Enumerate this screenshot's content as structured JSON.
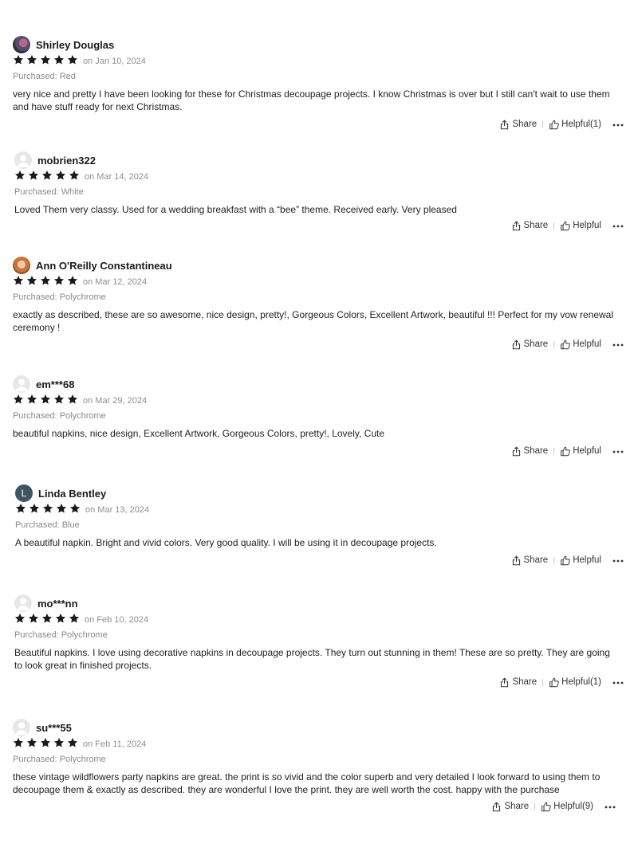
{
  "reviews": [
    {
      "name": "Shirley Douglas",
      "avatar": "photo-avatar-icon",
      "rating": 5,
      "date": "on Jan 10, 2024",
      "purchased": "Purchased: Red",
      "text": "very nice and pretty I have been looking for these for Christmas decoupage projects. I know Christmas is over but I still can't wait to use them and have stuff ready for next Christmas.",
      "share": "Share",
      "helpful": "Helpful(1)"
    },
    {
      "name": "mobrien322",
      "avatar": "default-avatar-icon",
      "rating": 5,
      "date": "on Mar 14, 2024",
      "purchased": "Purchased: White",
      "text": "Loved Them very classy. Used for a wedding breakfast with a “bee” theme. Received early. Very pleased",
      "share": "Share",
      "helpful": "Helpful"
    },
    {
      "name": "Ann O'Reilly Constantineau",
      "avatar": "photo-avatar-icon",
      "rating": 5,
      "date": "on Mar 12, 2024",
      "purchased": "Purchased: Polychrome",
      "text": "exactly as described, these are so awesome, nice design, pretty!, Gorgeous Colors, Excellent Artwork, beautiful !!! Perfect for my vow renewal ceremony !",
      "share": "Share",
      "helpful": "Helpful"
    },
    {
      "name": "em***68",
      "avatar": "default-avatar-icon",
      "rating": 5,
      "date": "on Mar 29, 2024",
      "purchased": "Purchased: Polychrome",
      "text": "beautiful napkins, nice design, Excellent Artwork, Gorgeous Colors, pretty!, Lovely, Cute",
      "share": "Share",
      "helpful": "Helpful"
    },
    {
      "name": "Linda Bentley",
      "avatar": "L",
      "rating": 5,
      "date": "on Mar 13, 2024",
      "purchased": "Purchased: Blue",
      "text": "A beautiful napkin. Bright and vivid colors. Very good quality. I will be using it in decoupage projects.",
      "share": "Share",
      "helpful": "Helpful"
    },
    {
      "name": "mo***nn",
      "avatar": "default-avatar-icon",
      "rating": 5,
      "date": "on Feb 10, 2024",
      "purchased": "Purchased: Polychrome",
      "text": "Beautiful napkins. I love using decorative napkins in decoupage projects. They turn out stunning in them! These are so pretty. They are going to look great in finished projects.",
      "share": "Share",
      "helpful": "Helpful(1)"
    },
    {
      "name": "su***55",
      "avatar": "default-avatar-icon",
      "rating": 5,
      "date": "on Feb 11, 2024",
      "purchased": "Purchased: Polychrome",
      "text": "these vintage wildflowers party napkins are great. the print is so vivid and the color superb and very detailed I look forward to using them to decoupage them & exactly as described. they are wonderful I love the print. they are well worth the cost. happy with the purchase",
      "share": "Share",
      "helpful": "Helpful(9)"
    }
  ],
  "colors": {
    "star": "#1a1a1a",
    "meta": "#8a8a8a",
    "letter_avatar": "#3f5462"
  }
}
